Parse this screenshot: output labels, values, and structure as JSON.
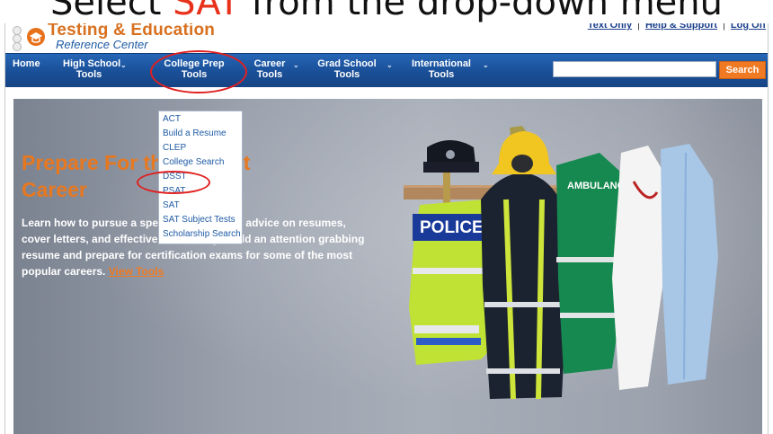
{
  "caption": {
    "before": "Select ",
    "highlight": "SAT",
    "after": " from the drop-down menu"
  },
  "logo": {
    "title": "Testing & Education",
    "subtitle": "Reference Center"
  },
  "util_links": {
    "text_only": "Text Only",
    "help": "Help & Support",
    "logout": "Log Off",
    "separator": "|"
  },
  "nav": {
    "home": "Home",
    "high_school": [
      "High School",
      "Tools"
    ],
    "college_prep": [
      "College Prep",
      "Tools"
    ],
    "career": [
      "Career",
      "Tools"
    ],
    "grad_school": [
      "Grad School",
      "Tools"
    ],
    "international": [
      "International",
      "Tools"
    ],
    "arrow": "⌄"
  },
  "search": {
    "placeholder": "",
    "button": "Search"
  },
  "hero": {
    "title": "Prepare For the Perfect Career",
    "body": "Learn how to pursue a specific career, gain advice on resumes, cover letters, and effective networking. Build an attention grabbing resume and prepare for certification exams for some of the most popular careers.",
    "link": "View Tools"
  },
  "dropdown": {
    "items": [
      "ACT",
      "Build a Resume",
      "CLEP",
      "College Search",
      "DSST",
      "PSAT",
      "SAT",
      "SAT Subject Tests",
      "Scholarship Search"
    ]
  },
  "colors": {
    "nav_blue": "#1a4f97",
    "accent_orange": "#ef7a23",
    "highlight_red": "#e02020",
    "link_blue": "#1e5aa4"
  }
}
